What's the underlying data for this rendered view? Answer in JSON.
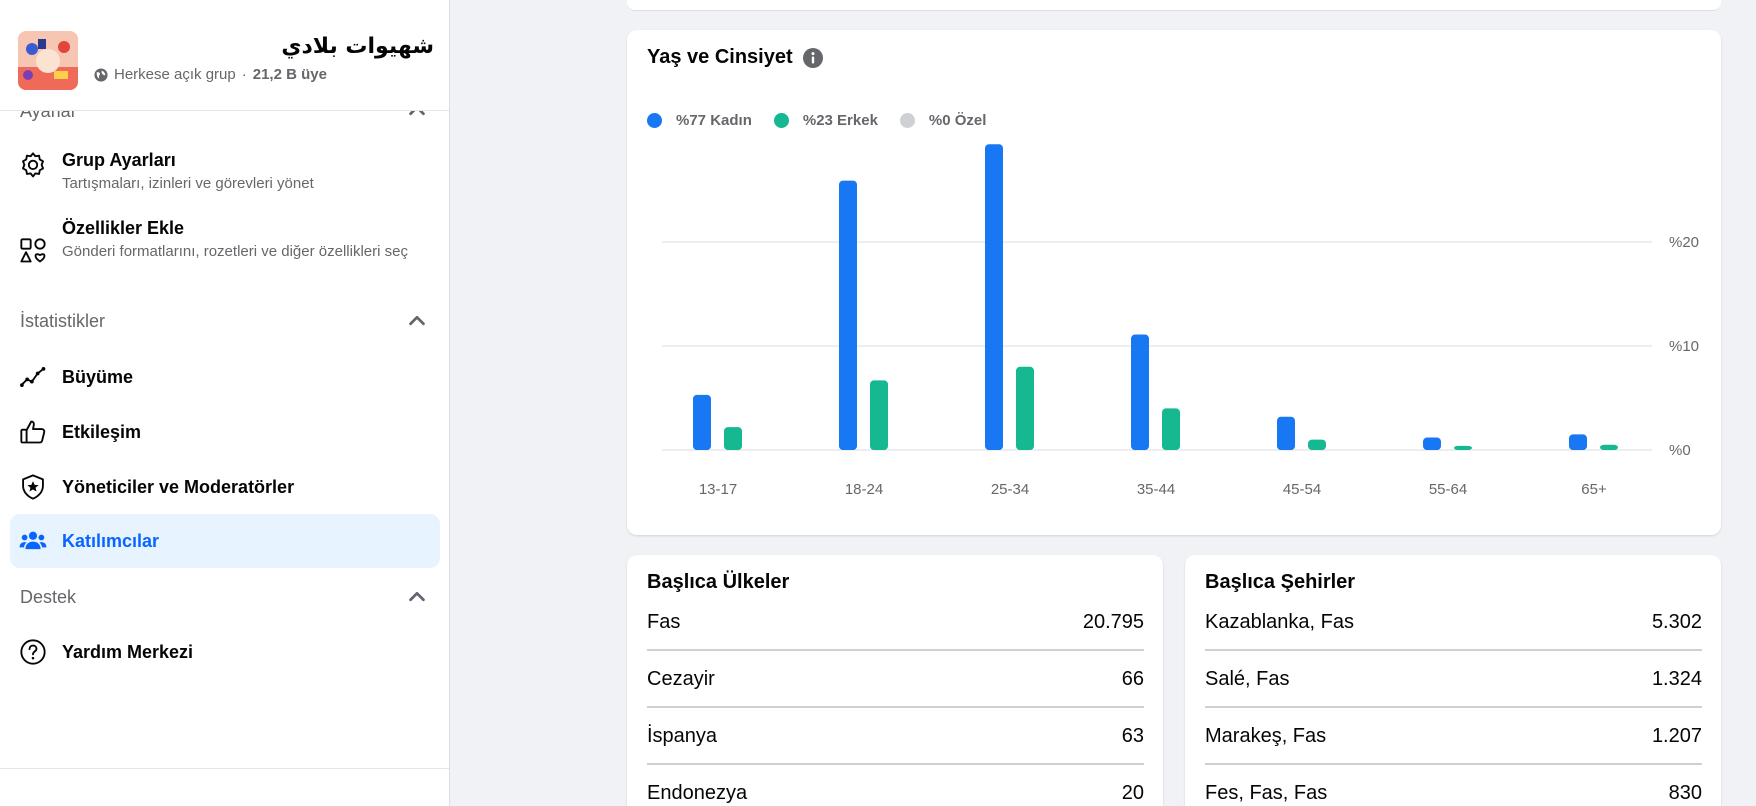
{
  "group": {
    "name": "شهيوات بلادي",
    "privacy": "Herkese açık grup",
    "separator": "·",
    "members": "21,2 B üye"
  },
  "sidebar": {
    "sections": [
      {
        "label": "Ayarlar"
      },
      {
        "label": "İstatistikler"
      },
      {
        "label": "Destek"
      }
    ],
    "items": [
      {
        "title": "Grup Ayarları",
        "sub": "Tartışmaları, izinleri ve görevleri yönet",
        "icon": "gear-icon"
      },
      {
        "title": "Özellikler Ekle",
        "sub": "Gönderi formatlarını, rozetleri ve diğer özellikleri seç",
        "icon": "shapes-icon"
      },
      {
        "title": "Büyüme",
        "icon": "growth-line-icon"
      },
      {
        "title": "Etkileşim",
        "icon": "thumbs-up-icon"
      },
      {
        "title": "Yöneticiler ve Moderatörler",
        "icon": "shield-star-icon"
      },
      {
        "title": "Katılımcılar",
        "icon": "people-icon"
      },
      {
        "title": "Yardım Merkezi",
        "icon": "question-circle-icon"
      }
    ]
  },
  "chart_card": {
    "title": "Yaş ve Cinsiyet",
    "legend": [
      {
        "label": "%77 Kadın",
        "color": "#1877f2"
      },
      {
        "label": "%23 Erkek",
        "color": "#16b892"
      },
      {
        "label": "%0 Özel",
        "color": "#ced0d4"
      }
    ]
  },
  "chart_data": {
    "type": "bar",
    "title": "Yaş ve Cinsiyet",
    "categories": [
      "13-17",
      "18-24",
      "25-34",
      "35-44",
      "45-54",
      "55-64",
      "65+"
    ],
    "series": [
      {
        "name": "%77 Kadın",
        "color": "#1877f2",
        "values": [
          5.3,
          25.9,
          29.4,
          11.1,
          3.2,
          1.2,
          1.5
        ]
      },
      {
        "name": "%23 Erkek",
        "color": "#16b892",
        "values": [
          2.2,
          6.7,
          8.0,
          4.0,
          1.0,
          0.4,
          0.5
        ]
      }
    ],
    "yticks": [
      0,
      10,
      20
    ],
    "ytick_labels": [
      "%0",
      "%10",
      "%20"
    ],
    "ylim": [
      0,
      30
    ],
    "grid": true,
    "legend_position": "top-left"
  },
  "countries": {
    "title": "Başlıca Ülkeler",
    "rows": [
      {
        "name": "Fas",
        "value": "20.795"
      },
      {
        "name": "Cezayir",
        "value": "66"
      },
      {
        "name": "İspanya",
        "value": "63"
      },
      {
        "name": "Endonezya",
        "value": "20"
      }
    ]
  },
  "cities": {
    "title": "Başlıca Şehirler",
    "rows": [
      {
        "name": "Kazablanka, Fas",
        "value": "5.302"
      },
      {
        "name": "Salé, Fas",
        "value": "1.324"
      },
      {
        "name": "Marakeş, Fas",
        "value": "1.207"
      },
      {
        "name": "Fes, Fas, Fas",
        "value": "830"
      }
    ]
  }
}
